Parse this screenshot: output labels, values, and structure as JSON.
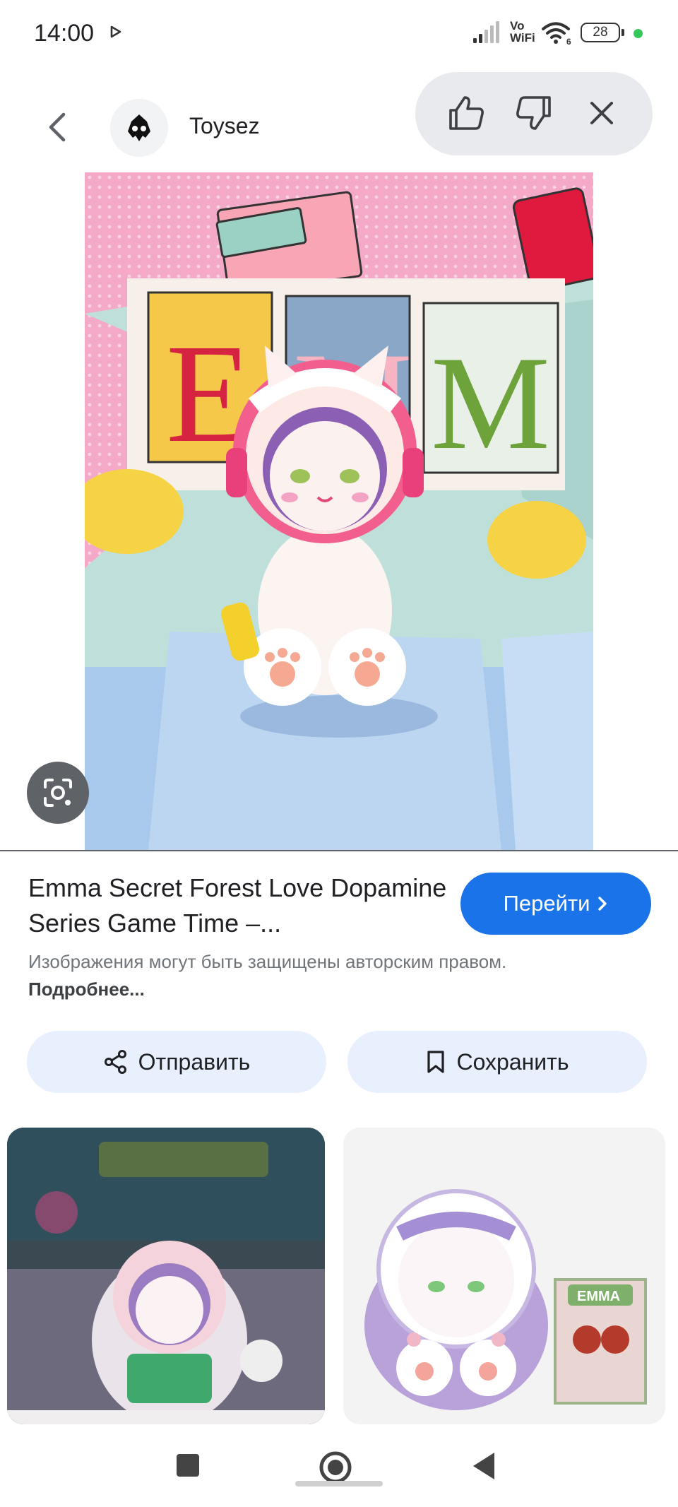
{
  "status_bar": {
    "time": "14:00",
    "vowifi_top": "Vo",
    "vowifi_bottom": "WiFi",
    "wifi_generation": "6",
    "battery": "28"
  },
  "header": {
    "back_icon": "chevron-left-icon",
    "source_name": "Toysez"
  },
  "feedback": {
    "like_icon": "thumb-up-icon",
    "dislike_icon": "thumb-down-icon",
    "close_icon": "close-icon"
  },
  "main_image": {
    "sign_letters": [
      "E",
      "M",
      "M"
    ]
  },
  "result": {
    "title": "Emma Secret Forest Love Dopamine Series Game Time –...",
    "visit_label": "Перейти",
    "copyright_text": "Изображения могут быть защищены авторским правом.",
    "learn_more": "Подробнее..."
  },
  "actions": {
    "share_label": "Отправить",
    "save_label": "Сохранить"
  },
  "related": {
    "box_label": "EMMA"
  },
  "colors": {
    "accent": "#1a73e8",
    "action_bg": "#e8f0fe",
    "feedback_bg": "#e8eaed"
  }
}
